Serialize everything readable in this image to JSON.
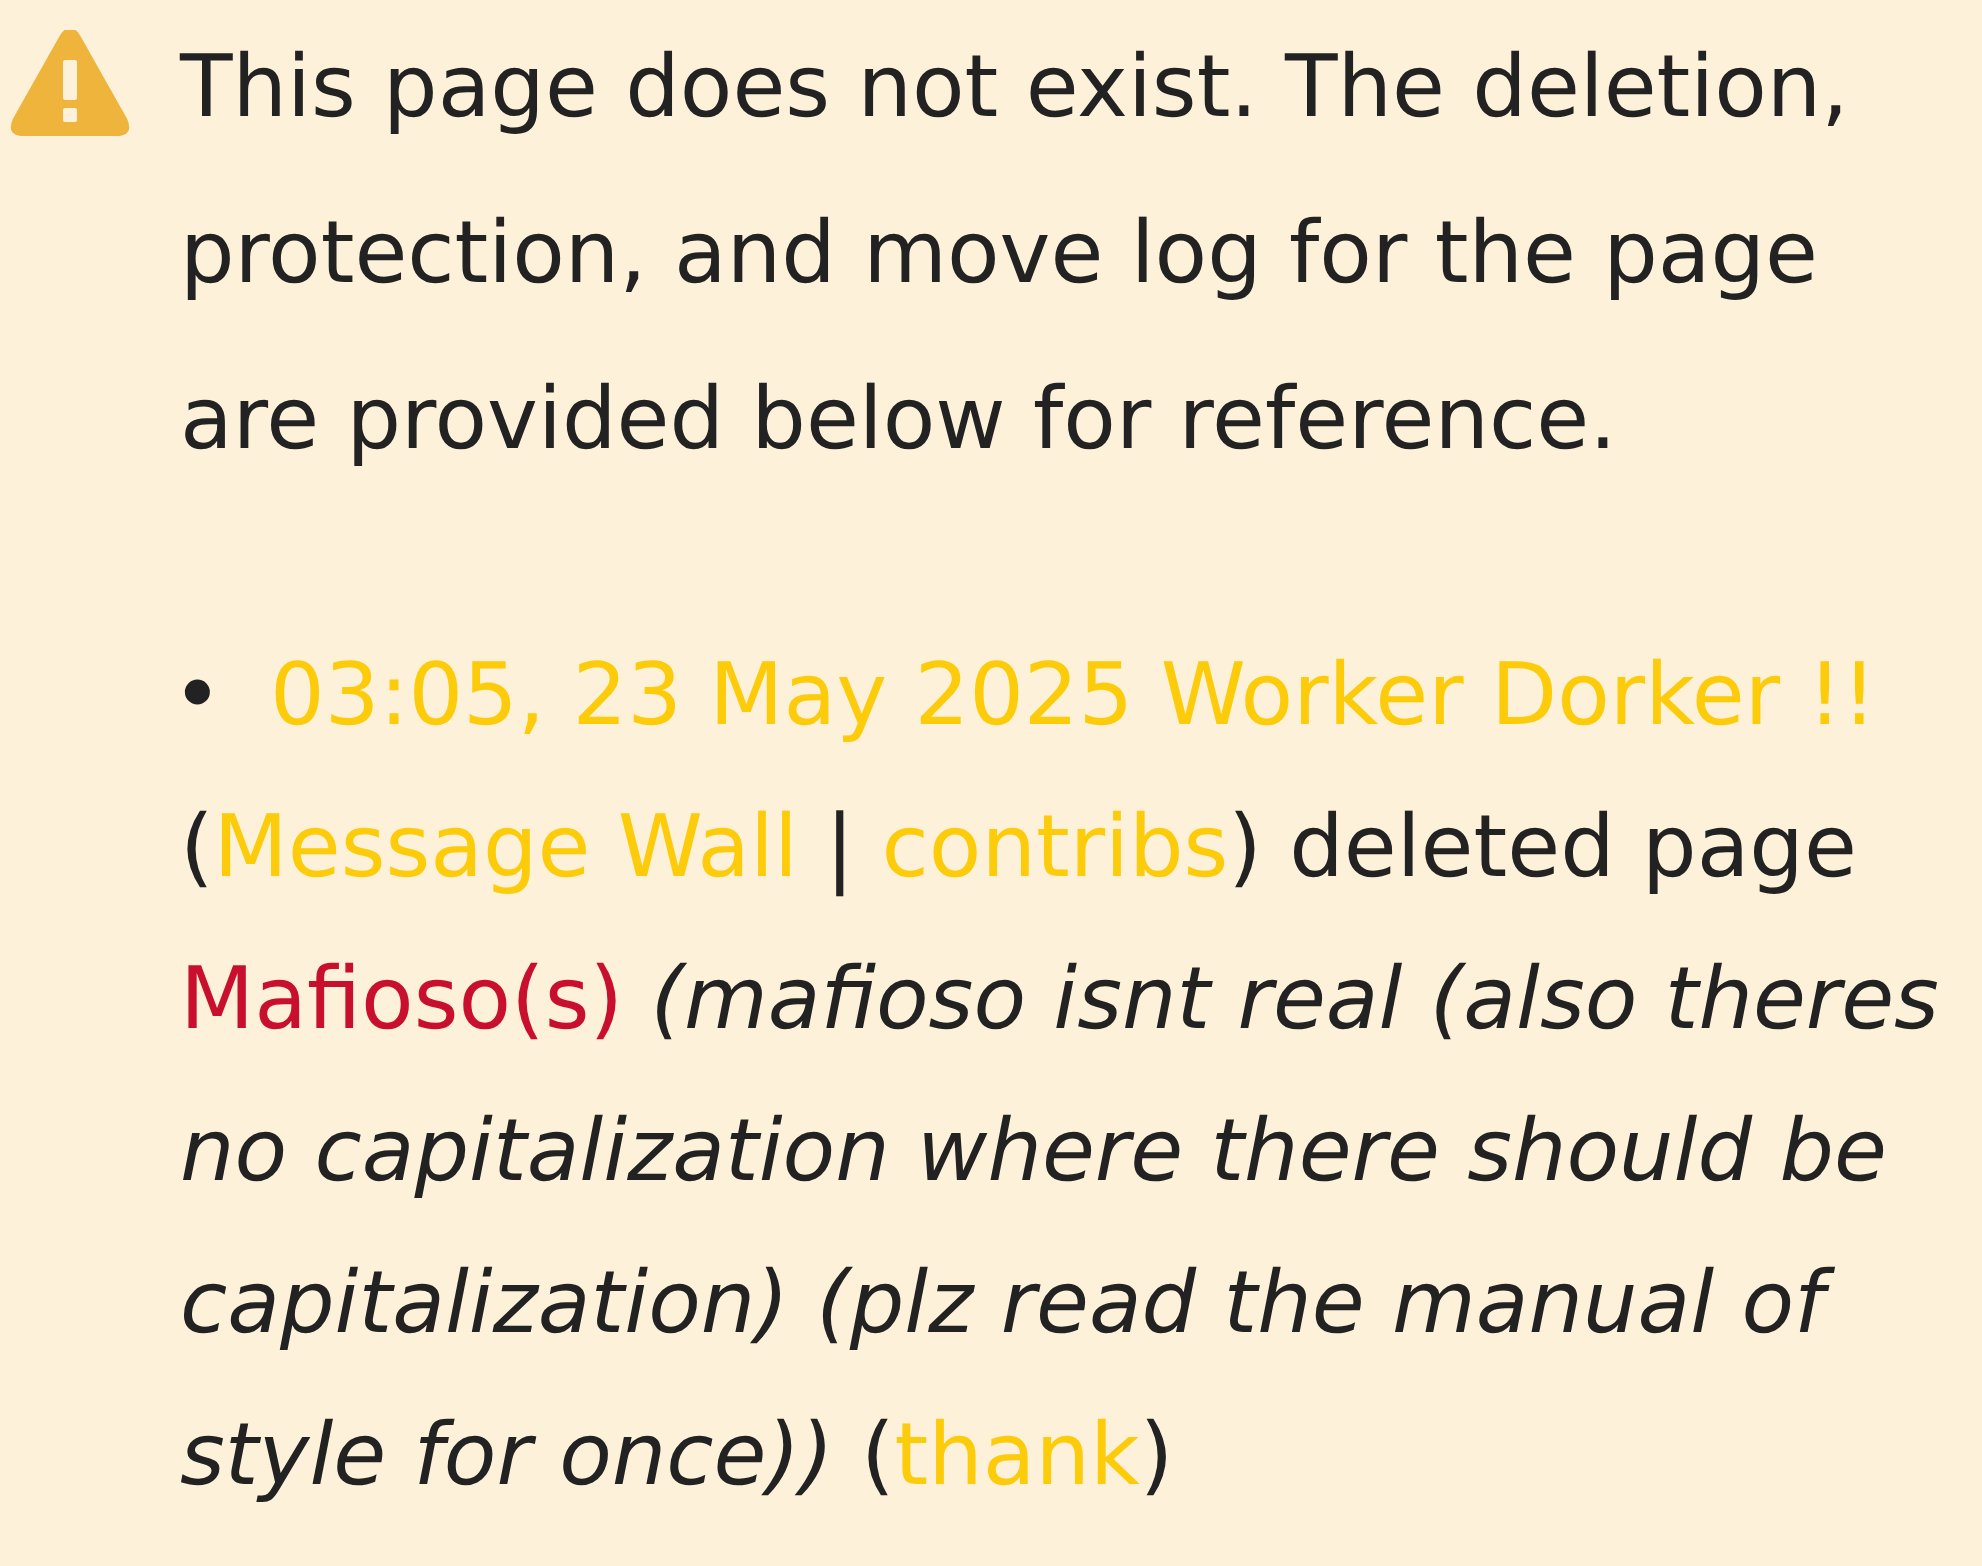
{
  "notice": {
    "text": "This page does not exist. The deletion, protection, and move log for the page are provided below for reference."
  },
  "log_entries": [
    {
      "marker": "•",
      "parts": [
        {
          "kind": "timestamp",
          "text": "03:05, 23 May 2025"
        },
        {
          "kind": "user",
          "text": "Worker Dorker !!"
        },
        {
          "kind": "user_tool",
          "before": "(",
          "text": "Message Wall"
        },
        {
          "kind": "separator",
          "text": "|"
        },
        {
          "kind": "user_tool",
          "text": "contribs",
          "after": ")"
        },
        {
          "kind": "text",
          "text": "deleted page"
        },
        {
          "kind": "page",
          "text": "Mafioso(s)"
        },
        {
          "kind": "comment",
          "text": "(mafioso isnt real (also theres no capitalization where there should be capitalization) (plz read the manual of style for once))"
        },
        {
          "kind": "thank",
          "before": "(",
          "text": "thank",
          "after": ")"
        }
      ]
    }
  ]
}
